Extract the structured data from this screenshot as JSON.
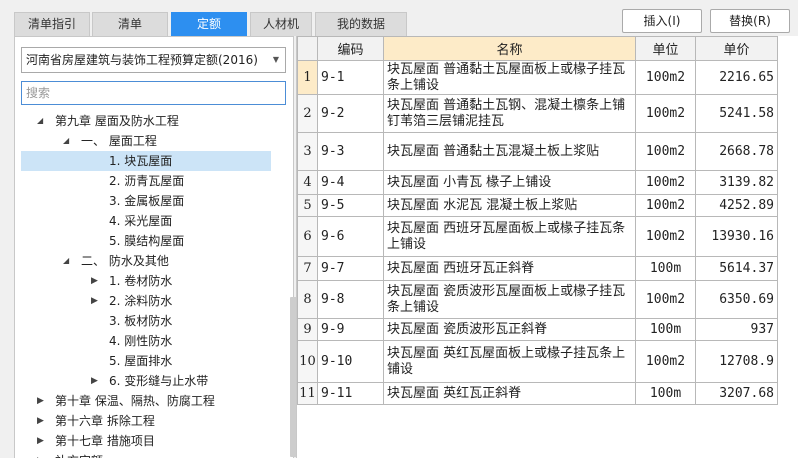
{
  "tabs": [
    {
      "label": "清单指引",
      "active": false
    },
    {
      "label": "清单",
      "active": false
    },
    {
      "label": "定额",
      "active": true
    },
    {
      "label": "人材机",
      "active": false
    },
    {
      "label": "我的数据",
      "active": false
    }
  ],
  "buttons": {
    "insert": "插入(I)",
    "replace": "替换(R)"
  },
  "quota_selector": {
    "value": "河南省房屋建筑与装饰工程预算定额(2016)"
  },
  "search": {
    "placeholder": "搜索"
  },
  "tree": [
    {
      "label": "第九章 屋面及防水工程",
      "level": 1,
      "state": "expanded"
    },
    {
      "label": "一、 屋面工程",
      "level": 2,
      "state": "expanded"
    },
    {
      "label": "1. 块瓦屋面",
      "level": 3,
      "state": "leaf",
      "selected": true
    },
    {
      "label": "2. 沥青瓦屋面",
      "level": 3,
      "state": "leaf"
    },
    {
      "label": "3. 金属板屋面",
      "level": 3,
      "state": "leaf"
    },
    {
      "label": "4. 采光屋面",
      "level": 3,
      "state": "leaf"
    },
    {
      "label": "5. 膜结构屋面",
      "level": 3,
      "state": "leaf"
    },
    {
      "label": "二、 防水及其他",
      "level": 2,
      "state": "expanded"
    },
    {
      "label": "1. 卷材防水",
      "level": 3,
      "state": "collapsed"
    },
    {
      "label": "2. 涂料防水",
      "level": 3,
      "state": "collapsed"
    },
    {
      "label": "3. 板材防水",
      "level": 3,
      "state": "leaf"
    },
    {
      "label": "4. 刚性防水",
      "level": 3,
      "state": "leaf"
    },
    {
      "label": "5. 屋面排水",
      "level": 3,
      "state": "leaf"
    },
    {
      "label": "6. 变形缝与止水带",
      "level": 3,
      "state": "collapsed"
    },
    {
      "label": "第十章 保温、隔热、防腐工程",
      "level": 1,
      "state": "collapsed"
    },
    {
      "label": "第十六章 拆除工程",
      "level": 1,
      "state": "collapsed"
    },
    {
      "label": "第十七章 措施项目",
      "level": 1,
      "state": "collapsed"
    },
    {
      "label": "补充定额",
      "level": 1,
      "state": "collapsed"
    }
  ],
  "table": {
    "headers": {
      "code": "编码",
      "name": "名称",
      "unit": "单位",
      "price": "单价"
    },
    "rows": [
      {
        "n": "1",
        "code": "9-1",
        "name": "块瓦屋面 普通黏土瓦屋面板上或椽子挂瓦条上铺设",
        "unit": "100m2",
        "price": "2216.65",
        "h": 34
      },
      {
        "n": "2",
        "code": "9-2",
        "name": "块瓦屋面 普通黏土瓦钢、混凝土檩条上铺钉苇箔三层铺泥挂瓦",
        "unit": "100m2",
        "price": "5241.58",
        "h": 38
      },
      {
        "n": "3",
        "code": "9-3",
        "name": "块瓦屋面 普通黏土瓦混凝土板上浆贴",
        "unit": "100m2",
        "price": "2668.78",
        "h": 38
      },
      {
        "n": "4",
        "code": "9-4",
        "name": "块瓦屋面 小青瓦 椽子上铺设",
        "unit": "100m2",
        "price": "3139.82",
        "h": 24
      },
      {
        "n": "5",
        "code": "9-5",
        "name": "块瓦屋面 水泥瓦 混凝土板上浆贴",
        "unit": "100m2",
        "price": "4252.89",
        "h": 22
      },
      {
        "n": "6",
        "code": "9-6",
        "name": "块瓦屋面 西班牙瓦屋面板上或椽子挂瓦条上铺设",
        "unit": "100m2",
        "price": "13930.16",
        "h": 40
      },
      {
        "n": "7",
        "code": "9-7",
        "name": "块瓦屋面 西班牙瓦正斜脊",
        "unit": "100m",
        "price": "5614.37",
        "h": 24
      },
      {
        "n": "8",
        "code": "9-8",
        "name": "块瓦屋面 瓷质波形瓦屋面板上或椽子挂瓦条上铺设",
        "unit": "100m2",
        "price": "6350.69",
        "h": 38
      },
      {
        "n": "9",
        "code": "9-9",
        "name": "块瓦屋面 瓷质波形瓦正斜脊",
        "unit": "100m",
        "price": "937",
        "h": 22
      },
      {
        "n": "10",
        "code": "9-10",
        "name": "块瓦屋面 英红瓦屋面板上或椽子挂瓦条上铺设",
        "unit": "100m2",
        "price": "12708.9",
        "h": 42
      },
      {
        "n": "11",
        "code": "9-11",
        "name": "块瓦屋面 英红瓦正斜脊",
        "unit": "100m",
        "price": "3207.68",
        "h": 22
      }
    ]
  }
}
